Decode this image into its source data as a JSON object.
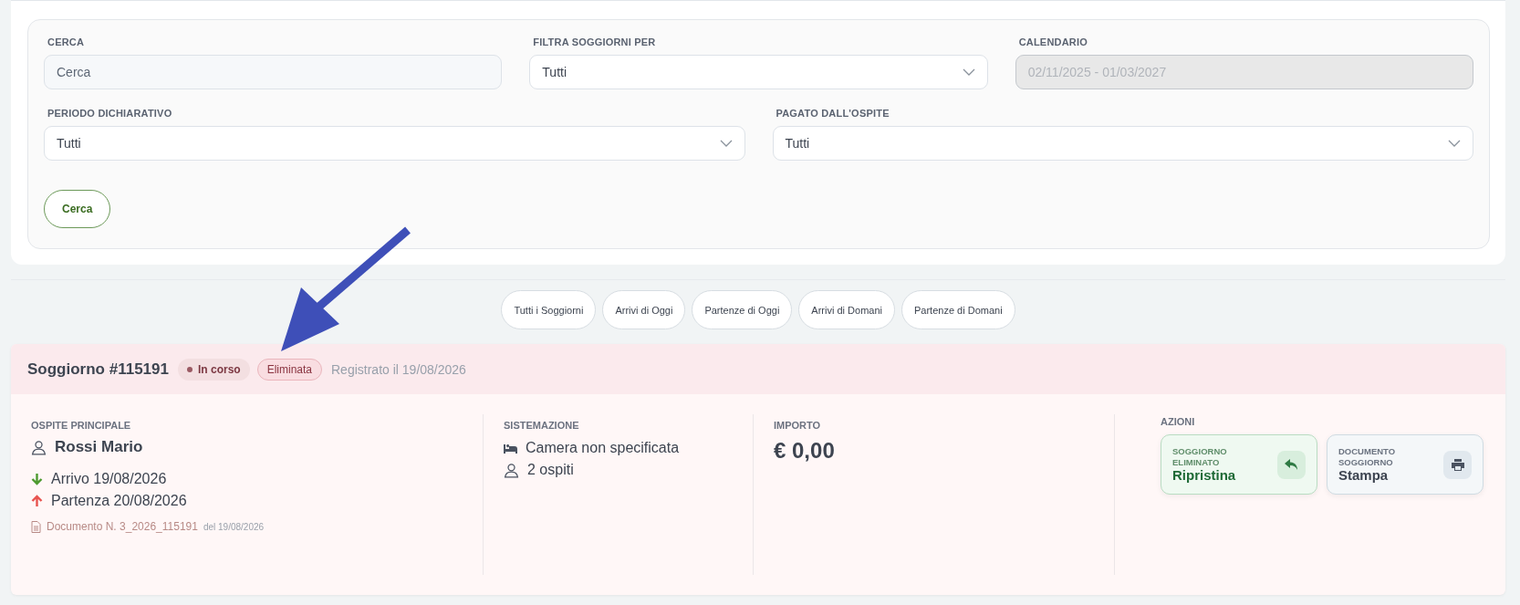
{
  "filters": [
    {
      "label": "CERCA",
      "kind": "text",
      "placeholder": "Cerca",
      "disabled": false
    },
    {
      "label": "FILTRA SOGGIORNI PER",
      "kind": "select",
      "value": "Tutti",
      "disabled": false
    },
    {
      "label": "CALENDARIO",
      "kind": "text",
      "value": "02/11/2025 - 01/03/2027",
      "disabled": true
    },
    {
      "label": "PERIODO DICHIARATIVO",
      "kind": "select",
      "value": "Tutti",
      "disabled": false
    },
    {
      "label": "PAGATO DALL'OSPITE",
      "kind": "select",
      "value": "Tutti",
      "disabled": false
    }
  ],
  "search_button": "Cerca",
  "quick_filters": [
    "Tutti i Soggiorni",
    "Arrivi di Oggi",
    "Partenze di Oggi",
    "Arrivi di Domani",
    "Partenze di Domani"
  ],
  "stay": {
    "title": "Soggiorno #115191",
    "status": "In corso",
    "deleted_badge": "Eliminata",
    "registered": "Registrato il 19/08/2026",
    "guest": {
      "label": "OSPITE PRINCIPALE",
      "name": "Rossi Mario",
      "arrival": "Arrivo 19/08/2026",
      "departure": "Partenza 20/08/2026",
      "document": "Documento N. 3_2026_115191",
      "document_date": "del 19/08/2026"
    },
    "accommodation": {
      "label": "SISTEMAZIONE",
      "room": "Camera non specificata",
      "guests": "2 ospiti"
    },
    "amount": {
      "label": "IMPORTO",
      "value": "€ 0,00"
    },
    "actions": {
      "label": "AZIONI",
      "items": [
        {
          "kind": "restore",
          "caption": "SOGGIORNO ELIMINATO",
          "label": "Ripristina"
        },
        {
          "kind": "print",
          "caption": "DOCUMENTO SOGGIORNO",
          "label": "Stampa"
        }
      ]
    }
  }
}
